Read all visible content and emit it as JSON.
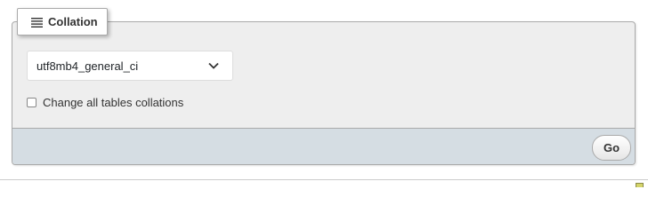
{
  "collation_panel": {
    "legend_label": "Collation",
    "legend_icon": "list-icon",
    "select": {
      "selected_value": "utf8mb4_general_ci",
      "icon": "chevron-down-icon"
    },
    "checkbox": {
      "label": "Change all tables collations",
      "checked": false
    },
    "submit_label": "Go"
  },
  "colors": {
    "panel_bg": "#eeeeee",
    "footer_bg": "#d5dde3",
    "border": "#aaaaaa",
    "text": "#333333"
  }
}
